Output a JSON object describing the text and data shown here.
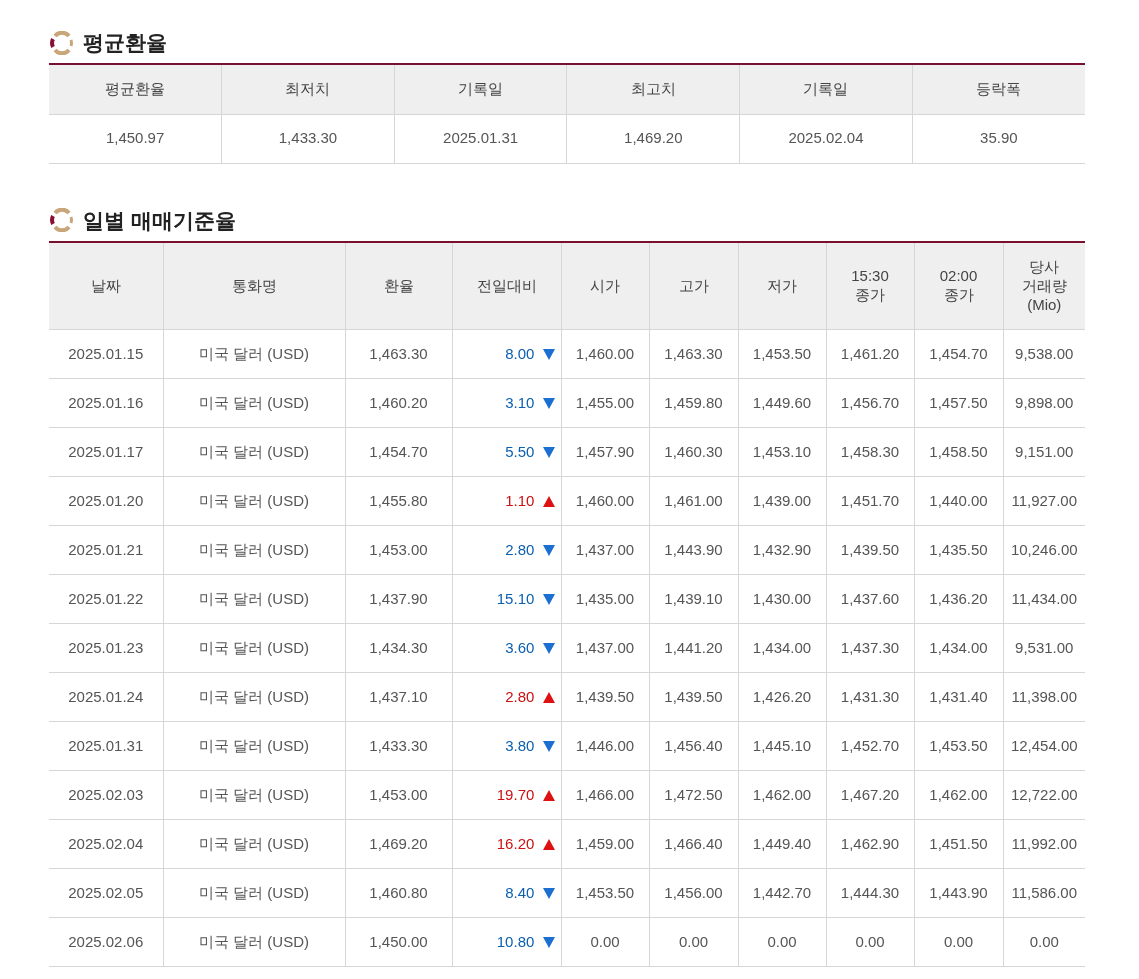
{
  "average_section": {
    "title": "평균환율",
    "columns": [
      "평균환율",
      "최저치",
      "기록일",
      "최고치",
      "기록일",
      "등락폭"
    ],
    "row": [
      "1,450.97",
      "1,433.30",
      "2025.01.31",
      "1,469.20",
      "2025.02.04",
      "35.90"
    ]
  },
  "daily_section": {
    "title": "일별 매매기준율",
    "columns": [
      "날짜",
      "통화명",
      "환율",
      "전일대비",
      "시가",
      "고가",
      "저가",
      "15:30\n종가",
      "02:00\n종가",
      "당사\n거래량\n(Mio)"
    ],
    "rows": [
      {
        "date": "2025.01.15",
        "currency": "미국 달러 (USD)",
        "rate": "1,463.30",
        "change": "8.00",
        "kind": "down",
        "open": "1,460.00",
        "high": "1,463.30",
        "low": "1,453.50",
        "close_1530": "1,461.20",
        "close_0200": "1,454.70",
        "volume": "9,538.00"
      },
      {
        "date": "2025.01.16",
        "currency": "미국 달러 (USD)",
        "rate": "1,460.20",
        "change": "3.10",
        "kind": "down",
        "open": "1,455.00",
        "high": "1,459.80",
        "low": "1,449.60",
        "close_1530": "1,456.70",
        "close_0200": "1,457.50",
        "volume": "9,898.00"
      },
      {
        "date": "2025.01.17",
        "currency": "미국 달러 (USD)",
        "rate": "1,454.70",
        "change": "5.50",
        "kind": "down",
        "open": "1,457.90",
        "high": "1,460.30",
        "low": "1,453.10",
        "close_1530": "1,458.30",
        "close_0200": "1,458.50",
        "volume": "9,151.00"
      },
      {
        "date": "2025.01.20",
        "currency": "미국 달러 (USD)",
        "rate": "1,455.80",
        "change": "1.10",
        "kind": "up",
        "open": "1,460.00",
        "high": "1,461.00",
        "low": "1,439.00",
        "close_1530": "1,451.70",
        "close_0200": "1,440.00",
        "volume": "11,927.00"
      },
      {
        "date": "2025.01.21",
        "currency": "미국 달러 (USD)",
        "rate": "1,453.00",
        "change": "2.80",
        "kind": "down",
        "open": "1,437.00",
        "high": "1,443.90",
        "low": "1,432.90",
        "close_1530": "1,439.50",
        "close_0200": "1,435.50",
        "volume": "10,246.00"
      },
      {
        "date": "2025.01.22",
        "currency": "미국 달러 (USD)",
        "rate": "1,437.90",
        "change": "15.10",
        "kind": "down",
        "open": "1,435.00",
        "high": "1,439.10",
        "low": "1,430.00",
        "close_1530": "1,437.60",
        "close_0200": "1,436.20",
        "volume": "11,434.00"
      },
      {
        "date": "2025.01.23",
        "currency": "미국 달러 (USD)",
        "rate": "1,434.30",
        "change": "3.60",
        "kind": "down",
        "open": "1,437.00",
        "high": "1,441.20",
        "low": "1,434.00",
        "close_1530": "1,437.30",
        "close_0200": "1,434.00",
        "volume": "9,531.00"
      },
      {
        "date": "2025.01.24",
        "currency": "미국 달러 (USD)",
        "rate": "1,437.10",
        "change": "2.80",
        "kind": "up",
        "open": "1,439.50",
        "high": "1,439.50",
        "low": "1,426.20",
        "close_1530": "1,431.30",
        "close_0200": "1,431.40",
        "volume": "11,398.00"
      },
      {
        "date": "2025.01.31",
        "currency": "미국 달러 (USD)",
        "rate": "1,433.30",
        "change": "3.80",
        "kind": "down",
        "open": "1,446.00",
        "high": "1,456.40",
        "low": "1,445.10",
        "close_1530": "1,452.70",
        "close_0200": "1,453.50",
        "volume": "12,454.00"
      },
      {
        "date": "2025.02.03",
        "currency": "미국 달러 (USD)",
        "rate": "1,453.00",
        "change": "19.70",
        "kind": "up",
        "open": "1,466.00",
        "high": "1,472.50",
        "low": "1,462.00",
        "close_1530": "1,467.20",
        "close_0200": "1,462.00",
        "volume": "12,722.00"
      },
      {
        "date": "2025.02.04",
        "currency": "미국 달러 (USD)",
        "rate": "1,469.20",
        "change": "16.20",
        "kind": "up",
        "open": "1,459.00",
        "high": "1,466.40",
        "low": "1,449.40",
        "close_1530": "1,462.90",
        "close_0200": "1,451.50",
        "volume": "11,992.00"
      },
      {
        "date": "2025.02.05",
        "currency": "미국 달러 (USD)",
        "rate": "1,460.80",
        "change": "8.40",
        "kind": "down",
        "open": "1,453.50",
        "high": "1,456.00",
        "low": "1,442.70",
        "close_1530": "1,444.30",
        "close_0200": "1,443.90",
        "volume": "11,586.00"
      },
      {
        "date": "2025.02.06",
        "currency": "미국 달러 (USD)",
        "rate": "1,450.00",
        "change": "10.80",
        "kind": "down",
        "open": "0.00",
        "high": "0.00",
        "low": "0.00",
        "close_1530": "0.00",
        "close_0200": "0.00",
        "volume": "0.00"
      }
    ]
  }
}
